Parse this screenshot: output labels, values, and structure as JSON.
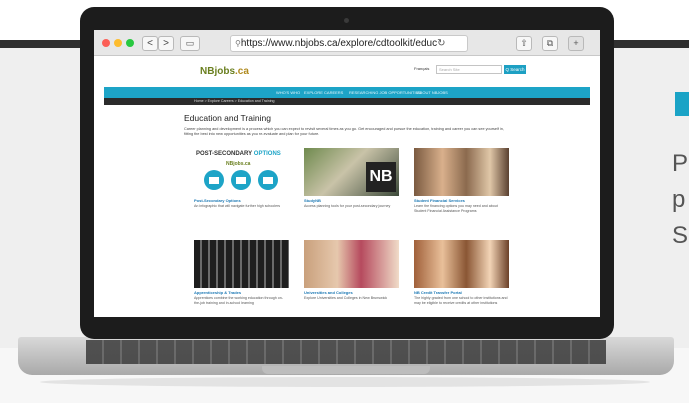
{
  "browser": {
    "url": "https://www.nbjobs.ca/explore/cdtoolkit/educ",
    "back_label": "<",
    "forward_label": ">"
  },
  "site": {
    "logo_main": "NBjobs",
    "logo_suffix": ".ca",
    "language_link": "Français",
    "search_placeholder": "Search Site",
    "search_button": "Q Search",
    "nav": [
      "WHO'S WHO",
      "EXPLORE CAREERS",
      "RESEARCHING JOB OPPORTUNITIES",
      "ABOUT NBJOBS"
    ],
    "breadcrumb": "Home > Explore Careers > Education and Training",
    "page_title": "Education and Training",
    "intro": "Career planning and development is a process which you can expect to revisit several times as you go. Get encouraged and pursue the education, training and career you can see yourself in, fitting the best into new opportunities as you re-evaluate and plan for your future."
  },
  "cards": [
    {
      "title": "Post-Secondary Options",
      "desc": "An infographic that will navigate further high schoolers"
    },
    {
      "title": "StudyNB",
      "desc": "Access planning tools for your post-secondary journey"
    },
    {
      "title": "Student Financial Services",
      "desc": "Learn the financing options you may need and about Student Financial Assistance Programs"
    },
    {
      "title": "Apprenticeship & Trades",
      "desc": "Apprentices combine the working education through on-the-job training and in-school learning"
    },
    {
      "title": "Universities and Colleges",
      "desc": "Explore Universities and Colleges in New Brunswick"
    },
    {
      "title": "NB Credit Transfer Portal",
      "desc": "The highly graded from one school to other institutions and may be eligible to receive credits at other institutions"
    }
  ],
  "promo": {
    "heading": "POST-SECONDARY",
    "heading_accent": "OPTIONS",
    "logo": "NBjobs.ca"
  },
  "side_text": [
    "P",
    "p",
    "S"
  ],
  "colors": {
    "accent": "#1da4c7",
    "logo_green": "#6a7f1f",
    "link_blue": "#1b78b4"
  }
}
